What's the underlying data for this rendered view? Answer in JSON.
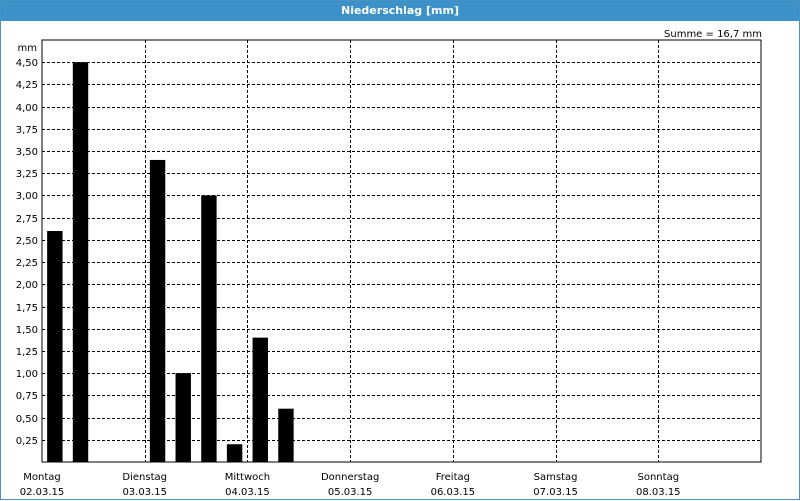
{
  "window": {
    "title": "Niederschlag [mm]"
  },
  "chart_data": {
    "type": "bar",
    "title": "Niederschlag [mm]",
    "ylabel": "mm",
    "annotation": "Summe = 16,7 mm",
    "ylim": [
      0,
      4.75
    ],
    "yticks": [
      "0,25",
      "0,50",
      "0,75",
      "1,00",
      "1,25",
      "1,50",
      "1,75",
      "2,00",
      "2,25",
      "2,50",
      "2,75",
      "3,00",
      "3,25",
      "3,50",
      "3,75",
      "4,00",
      "4,25",
      "4,50"
    ],
    "grid": true,
    "days": [
      {
        "name": "Montag",
        "date": "02.03.15"
      },
      {
        "name": "Dienstag",
        "date": "03.03.15"
      },
      {
        "name": "Mittwoch",
        "date": "04.03.15"
      },
      {
        "name": "Donnerstag",
        "date": "05.03.15"
      },
      {
        "name": "Freitag",
        "date": "06.03.15"
      },
      {
        "name": "Samstag",
        "date": "07.03.15"
      },
      {
        "name": "Sonntag",
        "date": "08.03.15"
      }
    ],
    "period_days": 7,
    "slots_per_day": 4,
    "values": [
      2.6,
      4.5,
      0,
      0,
      3.4,
      1.0,
      3.0,
      0.2,
      1.4,
      0.6,
      0,
      0,
      0,
      0,
      0,
      0,
      0,
      0,
      0,
      0,
      0,
      0,
      0,
      0,
      0,
      0,
      0,
      0
    ],
    "bar_color": "#000000"
  }
}
